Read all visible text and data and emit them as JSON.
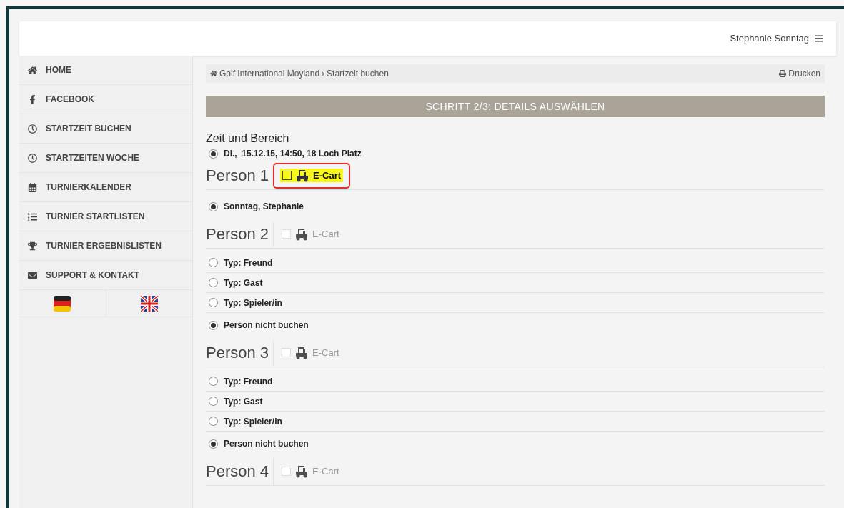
{
  "header": {
    "user": "Stephanie Sonntag"
  },
  "sidebar": {
    "items": [
      {
        "label": "HOME"
      },
      {
        "label": "FACEBOOK"
      },
      {
        "label": "STARTZEIT BUCHEN"
      },
      {
        "label": "STARTZEITEN WOCHE"
      },
      {
        "label": "TURNIERKALENDER"
      },
      {
        "label": "TURNIER STARTLISTEN"
      },
      {
        "label": "TURNIER ERGEBNISLISTEN"
      },
      {
        "label": "SUPPORT & KONTAKT"
      }
    ],
    "languages": [
      {
        "kind": "de"
      },
      {
        "kind": "uk"
      }
    ]
  },
  "breadcrumb": {
    "items": [
      "Golf International Moyland",
      "Startzeit buchen"
    ],
    "separator": "›",
    "print": "Drucken"
  },
  "step": "SCHRITT 2/3: DETAILS AUSWÄHLEN",
  "time_section": {
    "title": "Zeit und Bereich",
    "option": {
      "label": "Di.,  15.12.15, 14:50, 18 Loch Platz",
      "selected": true
    }
  },
  "persons": [
    {
      "title": "Person 1",
      "ecart": {
        "label": "E-Cart",
        "checked": false,
        "disabled": false,
        "highlighted": true
      },
      "options": [
        {
          "label": "Sonntag, Stephanie",
          "selected": true
        }
      ]
    },
    {
      "title": "Person 2",
      "ecart": {
        "label": "E-Cart",
        "checked": false,
        "disabled": true,
        "highlighted": false
      },
      "options": [
        {
          "label": "Typ: Freund",
          "selected": false
        },
        {
          "label": "Typ: Gast",
          "selected": false
        },
        {
          "label": "Typ: Spieler/in",
          "selected": false
        },
        {
          "label": "Person nicht buchen",
          "selected": true
        }
      ]
    },
    {
      "title": "Person 3",
      "ecart": {
        "label": "E-Cart",
        "checked": false,
        "disabled": true,
        "highlighted": false
      },
      "options": [
        {
          "label": "Typ: Freund",
          "selected": false
        },
        {
          "label": "Typ: Gast",
          "selected": false
        },
        {
          "label": "Typ: Spieler/in",
          "selected": false
        },
        {
          "label": "Person nicht buchen",
          "selected": true
        }
      ]
    },
    {
      "title": "Person 4",
      "ecart": {
        "label": "E-Cart",
        "checked": false,
        "disabled": true,
        "highlighted": false
      }
    }
  ]
}
